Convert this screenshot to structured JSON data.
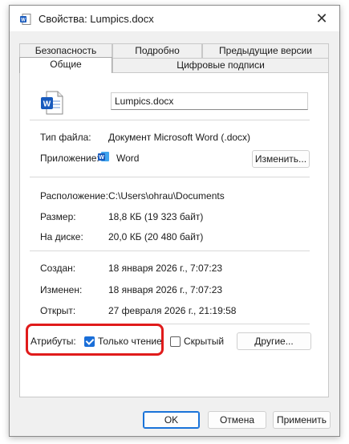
{
  "window": {
    "title": "Свойства: Lumpics.docx"
  },
  "tabs_row1": [
    {
      "label": "Безопасность"
    },
    {
      "label": "Подробно"
    },
    {
      "label": "Предыдущие версии"
    }
  ],
  "tabs_row2": [
    {
      "label": "Общие",
      "active": true
    },
    {
      "label": "Цифровые подписи"
    }
  ],
  "general": {
    "filename": "Lumpics.docx",
    "file_type_label": "Тип файла:",
    "file_type_value": "Документ Microsoft Word (.docx)",
    "app_label": "Приложение:",
    "app_value": "Word",
    "change_button": "Изменить...",
    "location_label": "Расположение:",
    "location_value": "C:\\Users\\ohrau\\Documents",
    "size_label": "Размер:",
    "size_value": "18,8 КБ (19 323 байт)",
    "disk_label": "На диске:",
    "disk_value": "20,0 КБ (20 480 байт)",
    "created_label": "Создан:",
    "created_value": "18 января 2026 г., 7:07:23",
    "modified_label": "Изменен:",
    "modified_value": "18 января 2026 г., 7:07:23",
    "opened_label": "Открыт:",
    "opened_value": "27 февраля 2026 г., 21:19:58",
    "attributes_label": "Атрибуты:",
    "readonly_label": "Только чтение",
    "readonly_checked": true,
    "hidden_label": "Скрытый",
    "hidden_checked": false,
    "other_button": "Другие..."
  },
  "footer": {
    "ok": "OK",
    "cancel": "Отмена",
    "apply": "Применить"
  },
  "colors": {
    "accent": "#1a6ed8",
    "highlight": "#e01b1b",
    "word_blue": "#185abd"
  }
}
